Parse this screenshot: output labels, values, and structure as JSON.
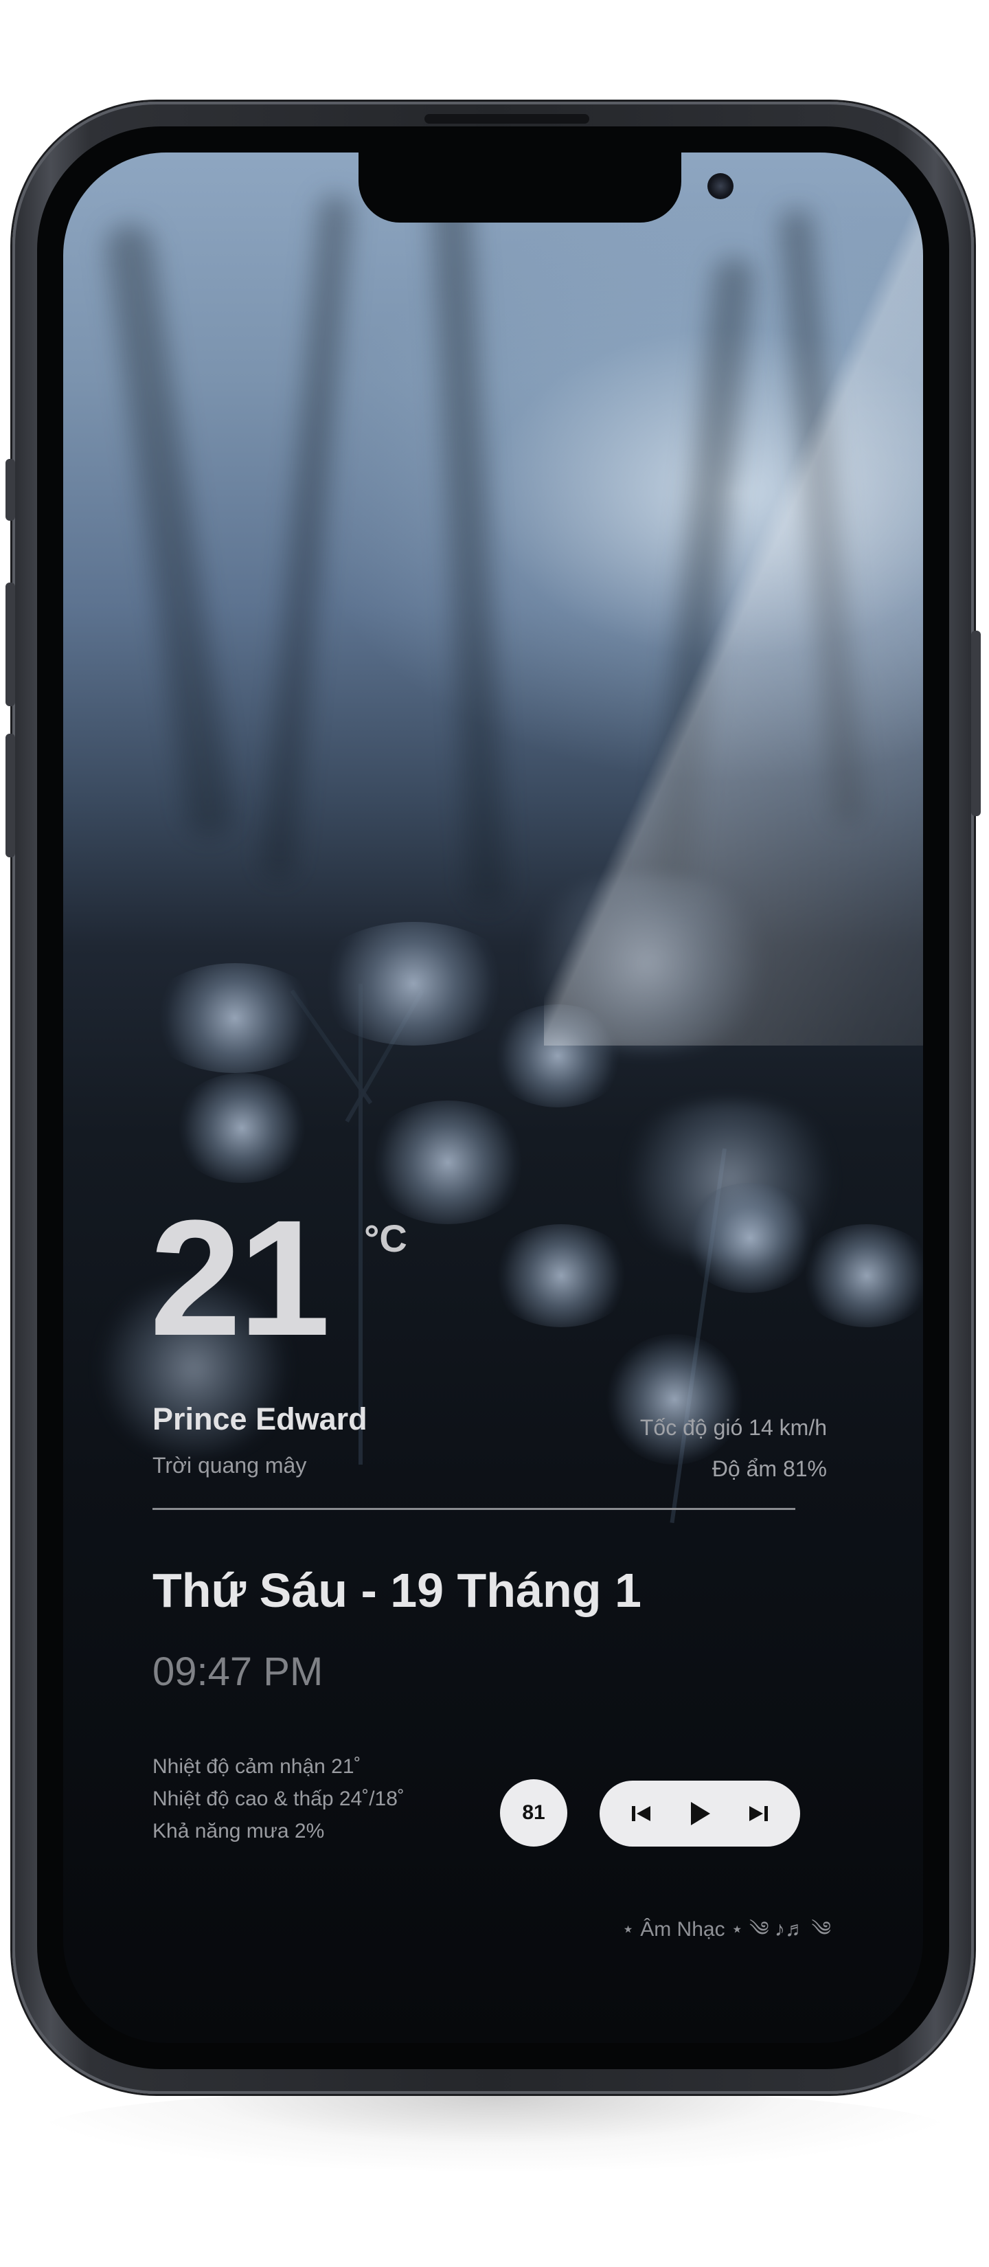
{
  "weather": {
    "temperature": "21",
    "unit": "°C",
    "city": "Prince Edward",
    "condition": "Trời quang mây",
    "wind": "Tốc độ gió 14 km/h",
    "humidity": "Độ ẩm 81%"
  },
  "datetime": {
    "date": "Thứ Sáu - 19 Tháng 1",
    "time": "09:47 PM"
  },
  "details": {
    "feels_like": "Nhiệt độ cảm nhận 21˚",
    "high_low": "Nhiệt độ cao & thấp 24˚/18˚",
    "rain_chance": "Khả năng mưa 2%"
  },
  "controls": {
    "badge": "81",
    "icons": [
      "previous-track-icon",
      "play-icon",
      "next-track-icon"
    ]
  },
  "footer": {
    "text": "⋆ Âm Nhạc ⋆ ༄ ♪♬ ༄"
  },
  "colors": {
    "accent": "#ececee",
    "text_primary": "#e2e2e4",
    "text_secondary": "#9a9ca1"
  }
}
